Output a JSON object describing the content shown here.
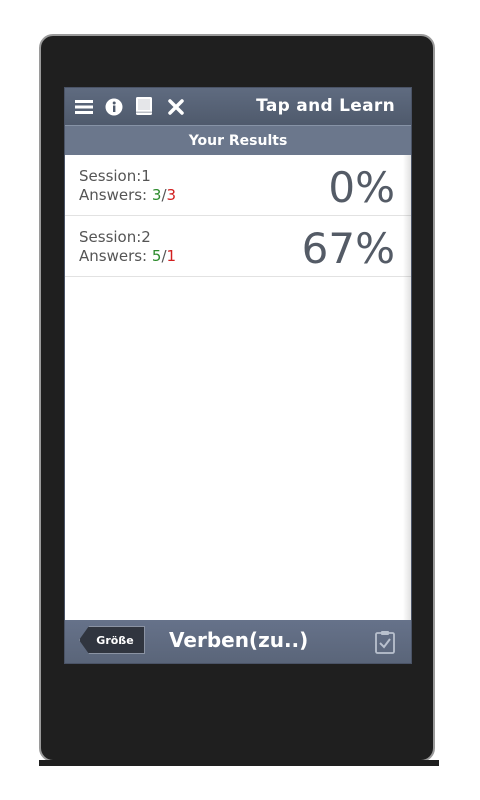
{
  "header": {
    "title": "Tap and Learn",
    "icons": [
      "menu-icon",
      "info-icon",
      "book-icon",
      "close-icon"
    ]
  },
  "subheader": {
    "title": "Your Results"
  },
  "sessions": [
    {
      "session_label": "Session:1",
      "answers_label": "Answers:",
      "correct": "3",
      "sep": "/",
      "wrong": "3",
      "percent": "0%"
    },
    {
      "session_label": "Session:2",
      "answers_label": "Answers:",
      "correct": "5",
      "sep": "/",
      "wrong": "1",
      "percent": "67%"
    }
  ],
  "footer": {
    "back_label": "Größe",
    "title": "Verben(zu..)",
    "right_icon": "clipboard-check-icon"
  },
  "colors": {
    "bar": "#5f6b80",
    "correct": "#2d8b2d",
    "wrong": "#d21f1f"
  }
}
